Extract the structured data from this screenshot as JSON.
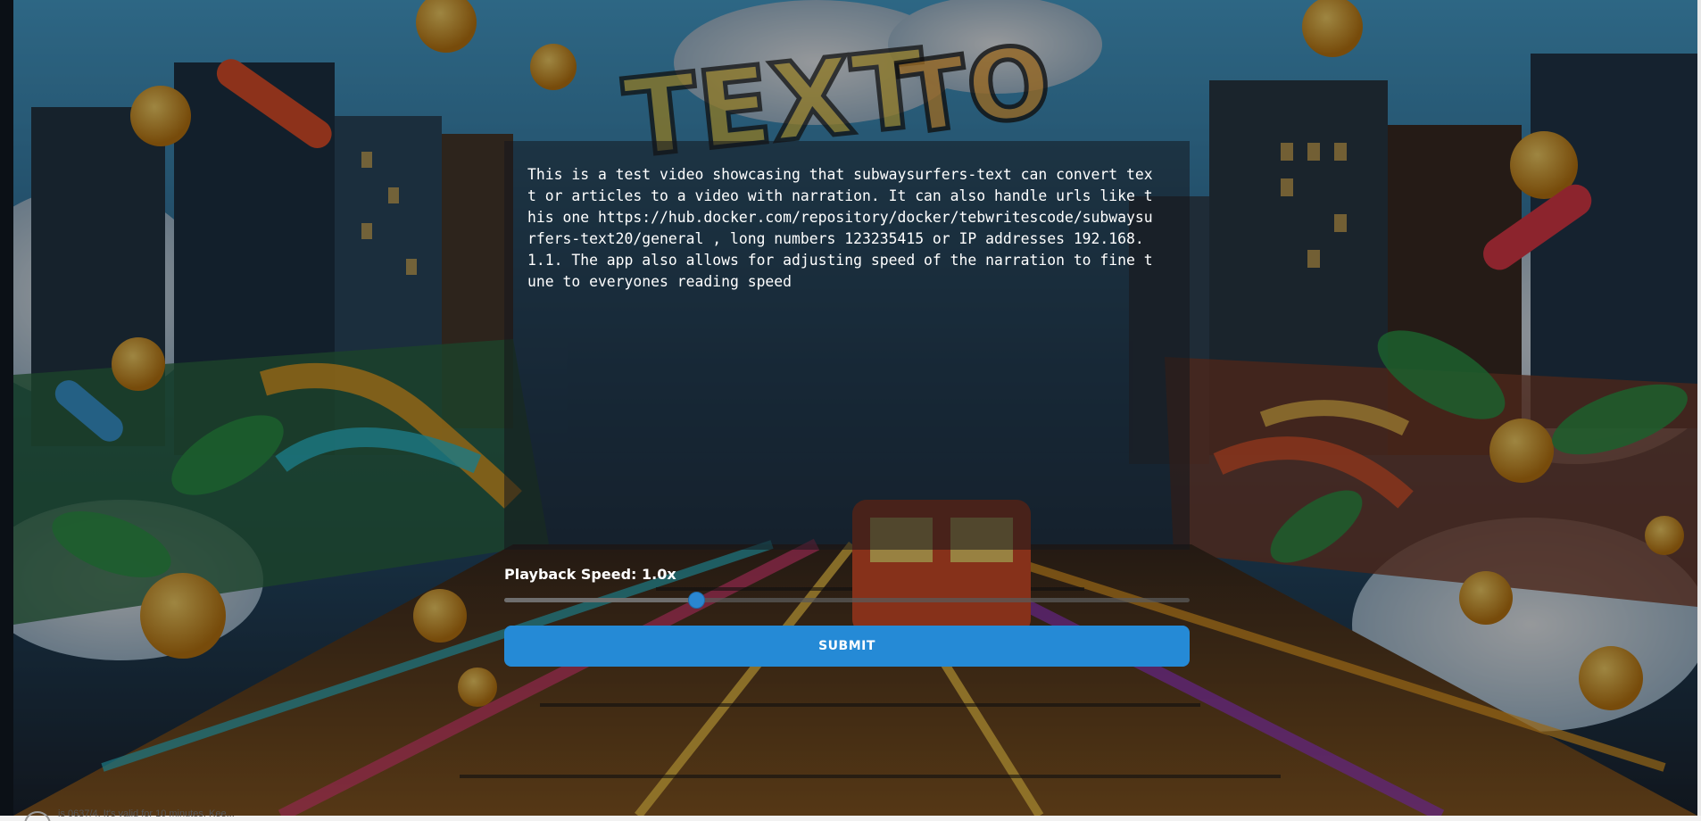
{
  "background": {
    "description_icon": "graffiti-subway-artwork",
    "colors": {
      "accent": "#258ad6",
      "sky": "#3a8fc4",
      "track": "#f2a22a"
    }
  },
  "form": {
    "text_content": "This is a test video showcasing that subwaysurfers-text can convert text or articles to a video with narration. It can also handle urls like this one https://hub.docker.com/repository/docker/tebwritescode/subwaysurfers-text20/general , long numbers 123235415 or IP addresses 192.168.1.1. The app also allows for adjusting speed of the narration to fine tune to everyones reading speed",
    "speed_label": "Playback Speed: 1.0x",
    "speed_value_fraction": 0.28,
    "submit_label": "SUBMIT"
  },
  "status_bar": {
    "notice_text": "is 0637/4. It's valid for 10 minutes. Kee..."
  }
}
